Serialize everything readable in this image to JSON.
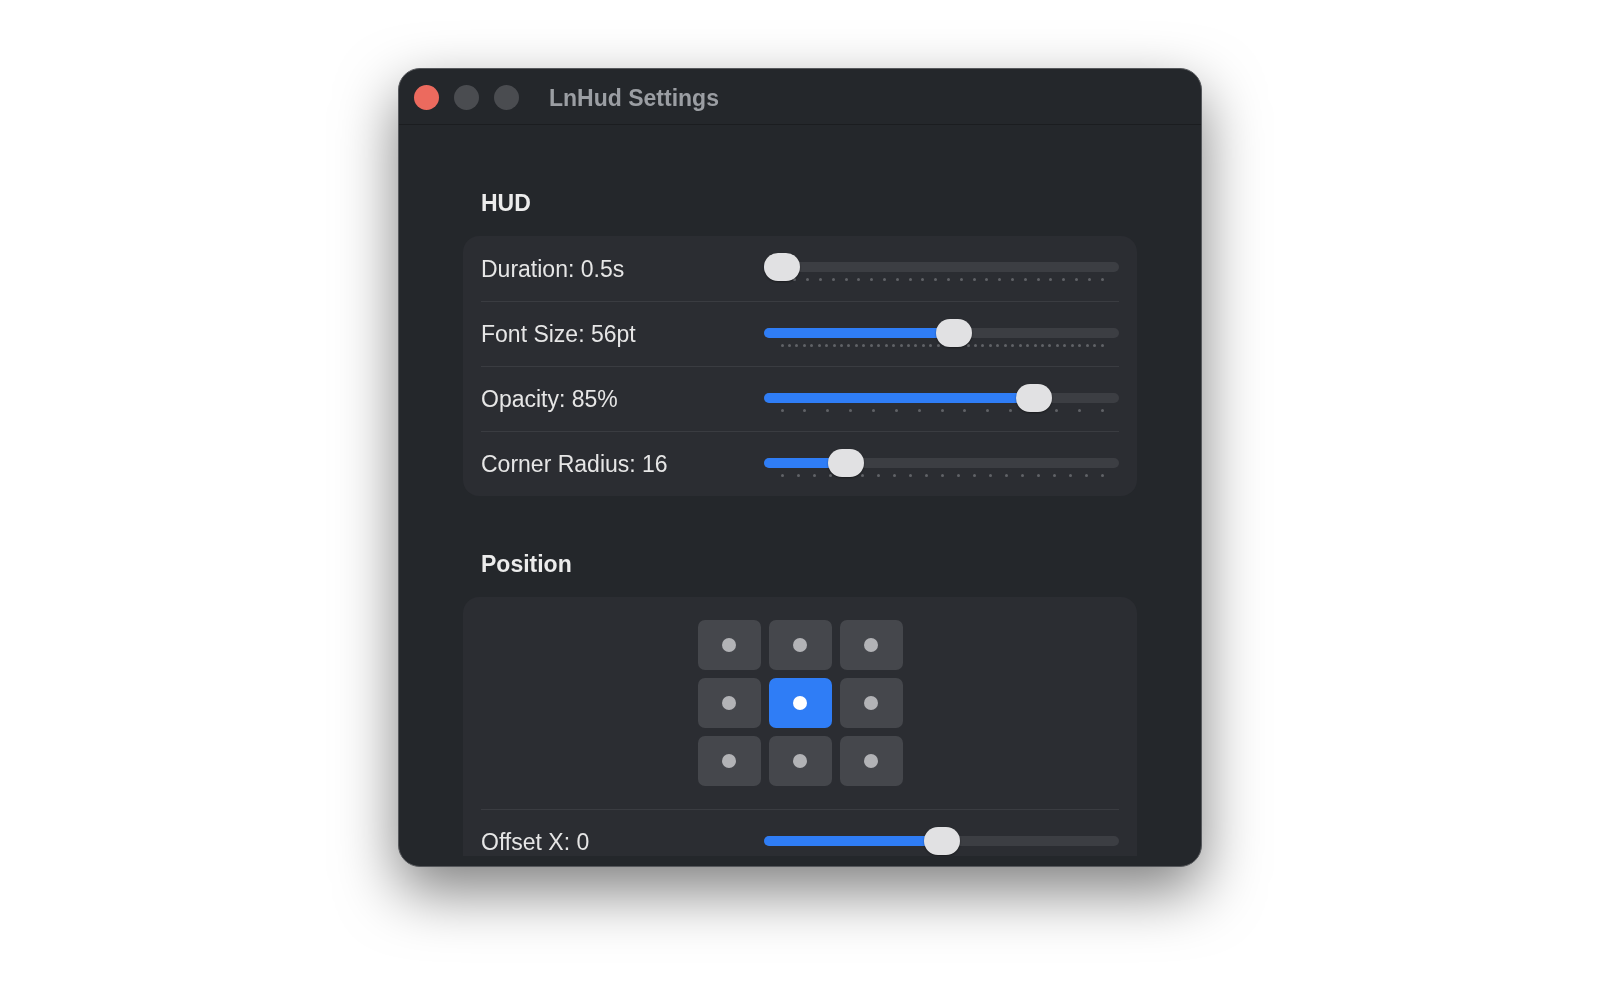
{
  "window": {
    "title": "LnHud Settings",
    "controls": [
      {
        "kind": "close",
        "disabled": false
      },
      {
        "kind": "minimize",
        "disabled": true
      },
      {
        "kind": "zoom",
        "disabled": true
      }
    ]
  },
  "sections": [
    {
      "heading": "HUD",
      "sliders": [
        {
          "label": "Duration: 0.5s",
          "level": 0
        },
        {
          "label": "Font Size: 56pt",
          "level": 0.54
        },
        {
          "label": "Opacity: 85%",
          "level": 0.79
        },
        {
          "label": "Corner Radius: 16",
          "level": 0.2
        }
      ]
    },
    {
      "heading": "Position",
      "position_grid": [
        {
          "selected": false
        },
        {
          "selected": false
        },
        {
          "selected": false
        },
        {
          "selected": false
        },
        {
          "selected": true
        },
        {
          "selected": false
        },
        {
          "selected": false
        },
        {
          "selected": false
        },
        {
          "selected": false
        }
      ],
      "sliders": [
        {
          "label": "Offset X: 0",
          "level": 0.5
        }
      ]
    }
  ]
}
